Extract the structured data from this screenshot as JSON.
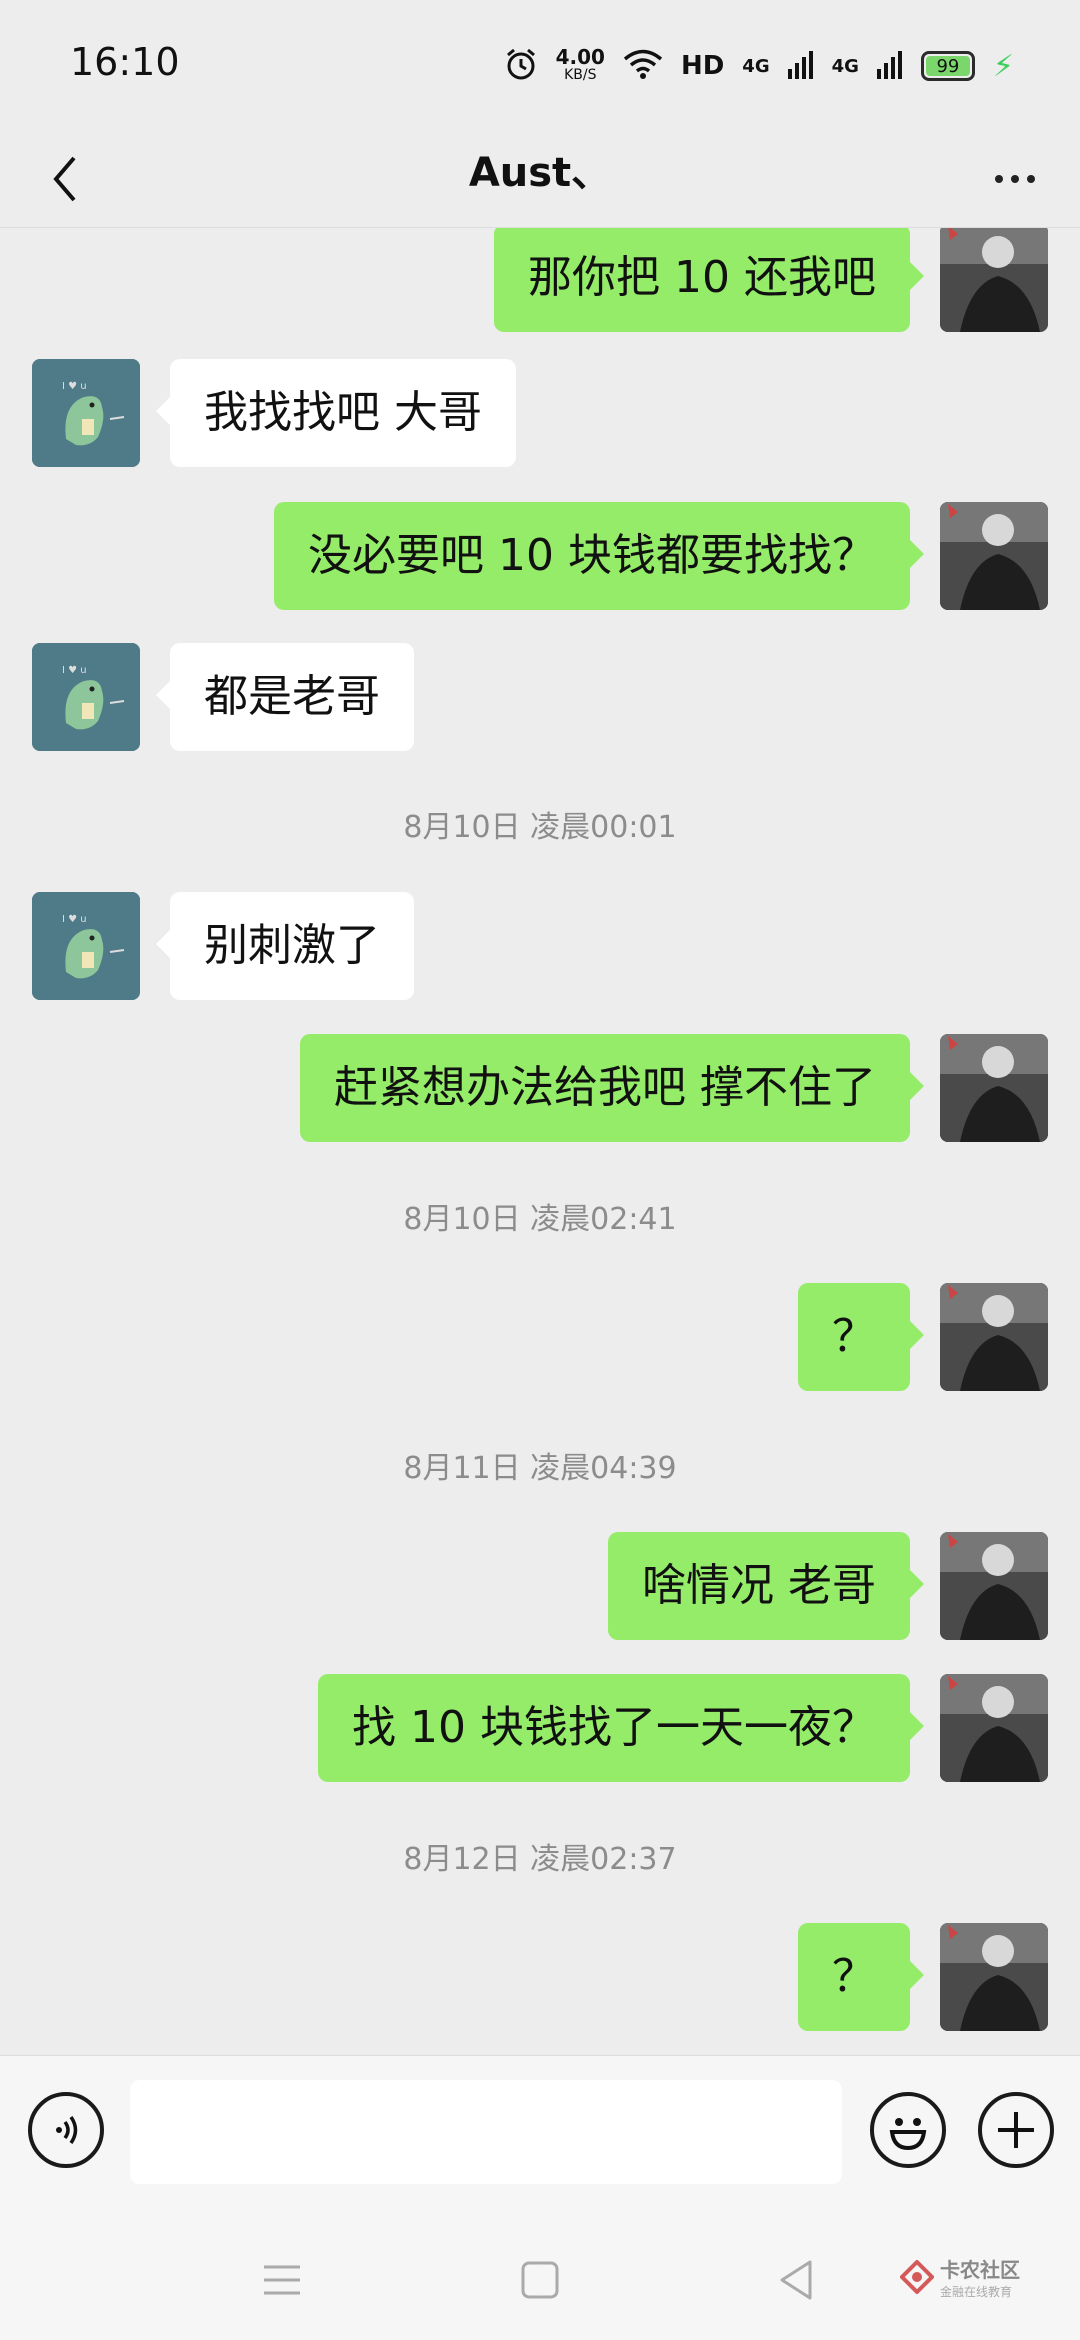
{
  "status_bar": {
    "time": "16:10",
    "speed_value": "4.00",
    "speed_unit": "KB/S",
    "hd_label": "HD",
    "network1": "4G",
    "network2": "4G",
    "battery": "99"
  },
  "header": {
    "title": "Aust、"
  },
  "messages": [
    {
      "side": "right",
      "text": "那你把 10 还我吧"
    },
    {
      "side": "left",
      "text": "我找找吧 大哥"
    },
    {
      "side": "right",
      "text": "没必要吧  10 块钱都要找找？"
    },
    {
      "side": "left",
      "text": "都是老哥"
    },
    {
      "type": "time",
      "text": "8月10日 凌晨00:01"
    },
    {
      "side": "left",
      "text": "别刺激了"
    },
    {
      "side": "right",
      "text": "赶紧想办法给我吧  撑不住了"
    },
    {
      "type": "time",
      "text": "8月10日 凌晨02:41"
    },
    {
      "side": "right",
      "text": "？"
    },
    {
      "type": "time",
      "text": "8月11日 凌晨04:39"
    },
    {
      "side": "right",
      "text": "啥情况 老哥"
    },
    {
      "side": "right",
      "text": "找 10 块钱找了一天一夜？"
    },
    {
      "type": "time",
      "text": "8月12日 凌晨02:37"
    },
    {
      "side": "right",
      "text": "？"
    }
  ],
  "input": {
    "value": "",
    "placeholder": ""
  },
  "watermark": {
    "main": "卡农社区",
    "sub": "金融在线教育"
  },
  "colors": {
    "background": "#ededed",
    "my_bubble": "#95ec69",
    "their_bubble": "#ffffff",
    "timestamp": "#8c8c8c"
  },
  "icons": [
    "back-arrow-icon",
    "more-dots-icon",
    "voice-icon",
    "emoji-icon",
    "plus-icon",
    "menu-nav-icon",
    "home-nav-icon",
    "back-nav-icon",
    "alarm-icon",
    "wifi-icon",
    "signal-icon",
    "battery-icon",
    "charging-icon"
  ]
}
